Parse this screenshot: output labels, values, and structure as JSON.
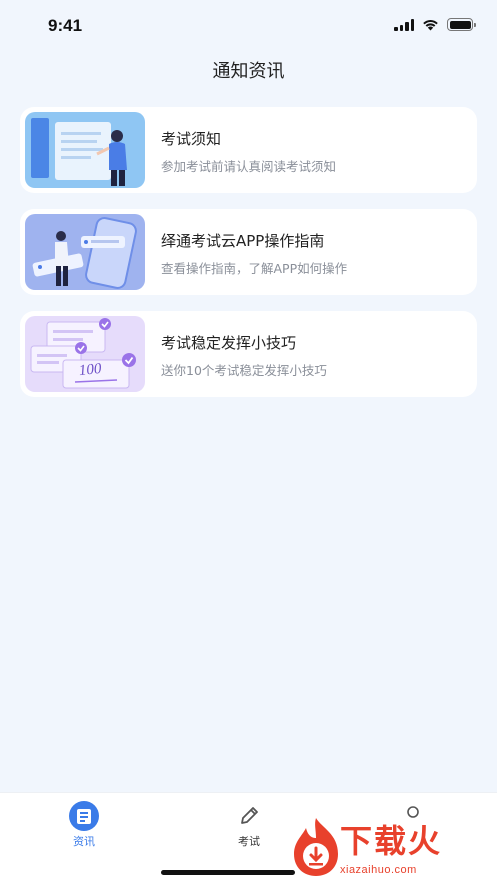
{
  "status": {
    "time": "9:41"
  },
  "header": {
    "title": "通知资讯"
  },
  "cards": [
    {
      "title": "考试须知",
      "subtitle": "参加考试前请认真阅读考试须知"
    },
    {
      "title": "绎通考试云APP操作指南",
      "subtitle": "查看操作指南，了解APP如何操作"
    },
    {
      "title": "考试稳定发挥小技巧",
      "subtitle": "送你10个考试稳定发挥小技巧"
    }
  ],
  "thumb3_score": "100",
  "tabs": [
    {
      "label": "资讯",
      "icon": "news-icon",
      "active": true
    },
    {
      "label": "考试",
      "icon": "pencil-icon",
      "active": false
    },
    {
      "label": "",
      "icon": "profile-icon",
      "active": false
    }
  ],
  "watermark": {
    "text": "下载火",
    "url": "xiazaihuo.com"
  },
  "colors": {
    "accent": "#3a7be8",
    "background": "#f1f6fd",
    "watermark": "#e8412c"
  }
}
